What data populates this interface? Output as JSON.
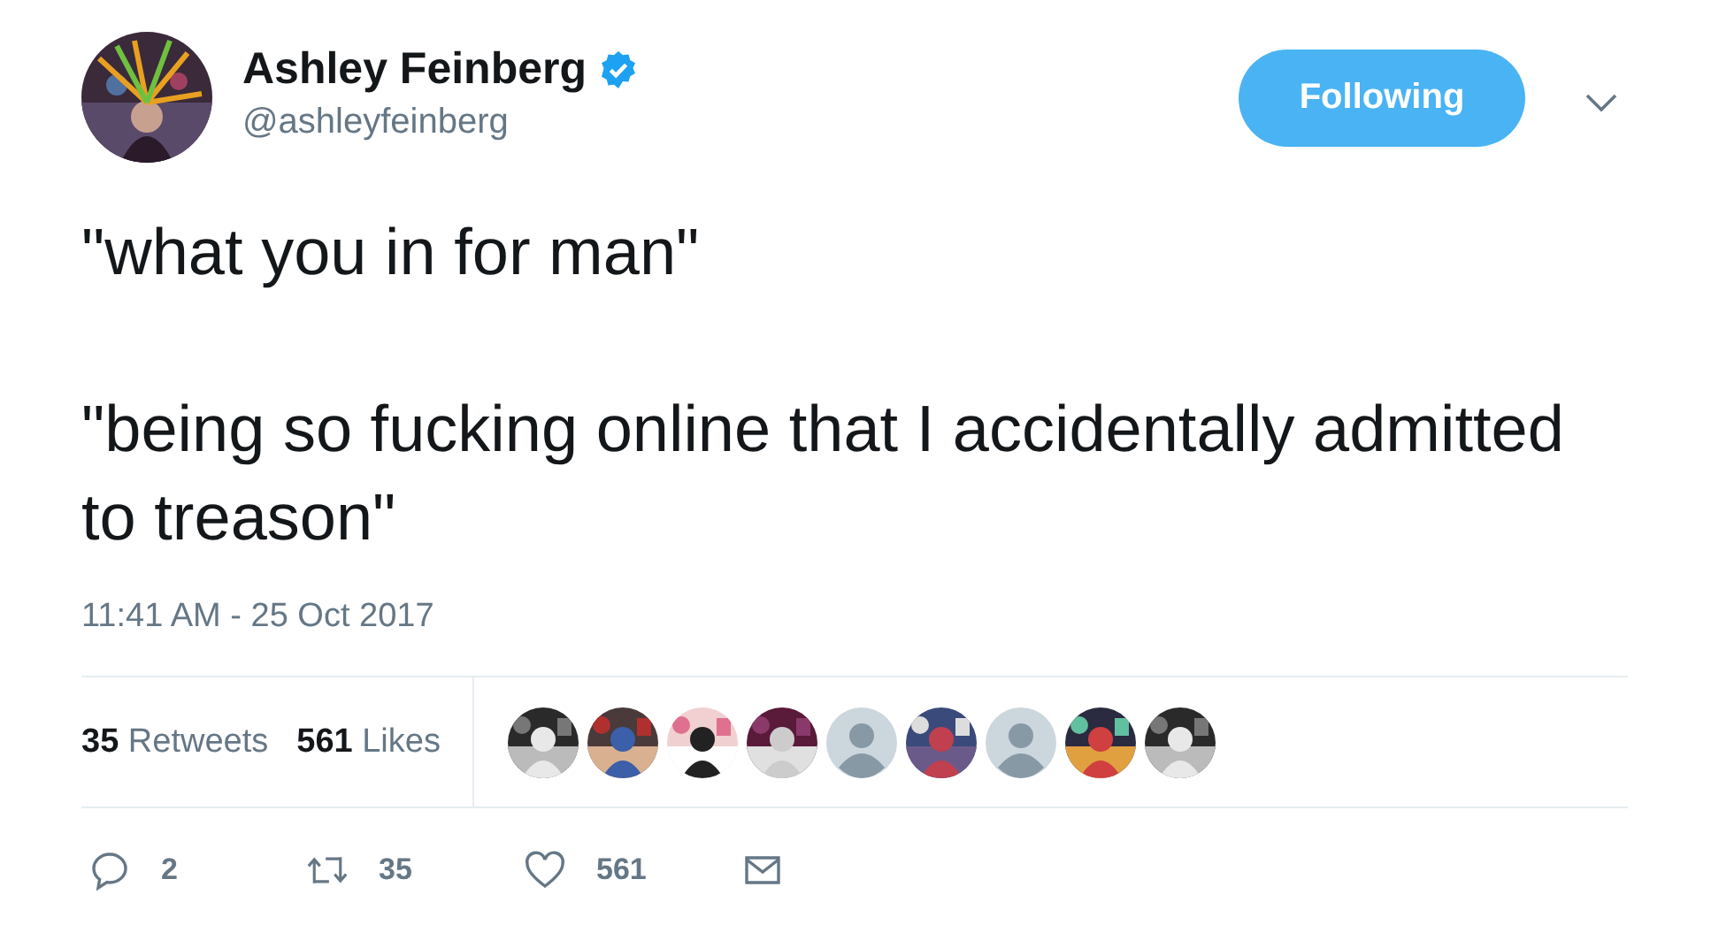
{
  "author": {
    "name": "Ashley Feinberg",
    "verified": true,
    "handle": "@ashleyfeinberg",
    "avatar": {
      "kind": "picture"
    }
  },
  "follow_button": {
    "label": "Following"
  },
  "tweet": {
    "paragraphs": [
      "\"what you in for man\"",
      "\"being so fucking online that I accidentally admitted to treason\""
    ]
  },
  "timestamp": "11:41 AM - 25 Oct 2017",
  "stats": [
    {
      "count": "35",
      "label": "Retweets"
    },
    {
      "count": "561",
      "label": "Likes"
    }
  ],
  "likers": [
    {
      "kind": "picture"
    },
    {
      "kind": "picture"
    },
    {
      "kind": "picture"
    },
    {
      "kind": "picture"
    },
    {
      "kind": "default"
    },
    {
      "kind": "picture"
    },
    {
      "kind": "default"
    },
    {
      "kind": "picture"
    },
    {
      "kind": "picture"
    }
  ],
  "actions": [
    {
      "kind": "reply",
      "count": "2"
    },
    {
      "kind": "retweet",
      "count": "35"
    },
    {
      "kind": "like",
      "count": "561"
    },
    {
      "kind": "message"
    }
  ]
}
